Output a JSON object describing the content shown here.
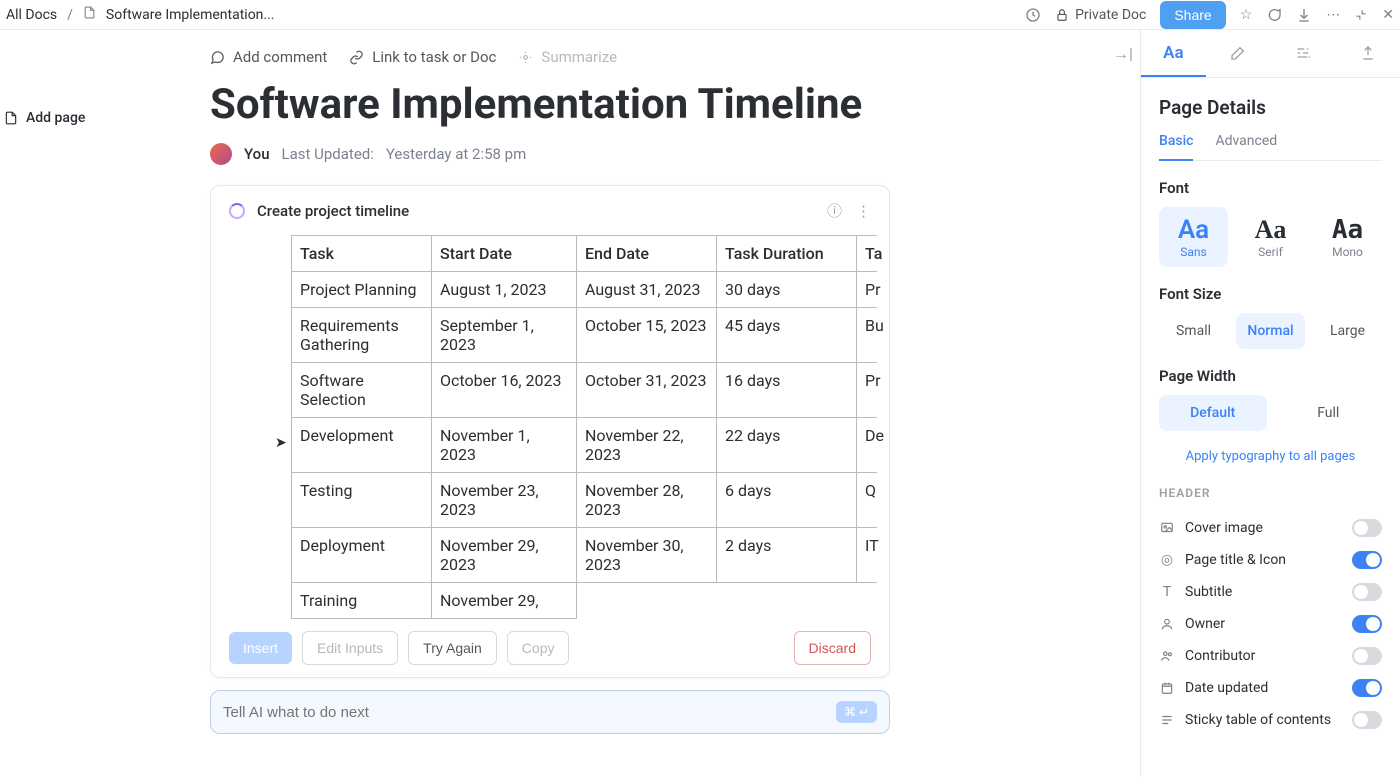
{
  "breadcrumb": {
    "root": "All Docs",
    "current": "Software Implementation..."
  },
  "topbar": {
    "privacy": "Private Doc",
    "share": "Share"
  },
  "left_rail": {
    "add_page": "Add page"
  },
  "doc_actions": {
    "comment": "Add comment",
    "link_task": "Link to task or Doc",
    "summarize": "Summarize"
  },
  "document": {
    "title": "Software Implementation Timeline",
    "author": "You",
    "last_updated_label": "Last Updated:",
    "last_updated_value": "Yesterday at 2:58 pm"
  },
  "ai_card": {
    "prompt_title": "Create project timeline",
    "columns": [
      "Task",
      "Start Date",
      "End Date",
      "Task Duration",
      "Ta"
    ],
    "rows": [
      {
        "task": "Project Planning",
        "start": "August 1, 2023",
        "end": "August 31, 2023",
        "dur": "30 days",
        "extra": "Pr"
      },
      {
        "task": "Requirements Gathering",
        "start": "September 1, 2023",
        "end": "October 15, 2023",
        "dur": "45 days",
        "extra": "Bu"
      },
      {
        "task": "Software Selection",
        "start": "October 16, 2023",
        "end": "October 31, 2023",
        "dur": "16 days",
        "extra": "Pr"
      },
      {
        "task": "Development",
        "start": "November 1, 2023",
        "end": "November 22, 2023",
        "dur": "22 days",
        "extra": "De"
      },
      {
        "task": "Testing",
        "start": "November 23, 2023",
        "end": "November 28, 2023",
        "dur": "6 days",
        "extra": "Q"
      },
      {
        "task": "Deployment",
        "start": "November 29, 2023",
        "end": "November 30, 2023",
        "dur": "2 days",
        "extra": "IT"
      },
      {
        "task": "Training",
        "start": "November 29,",
        "end": "",
        "dur": "",
        "extra": ""
      }
    ],
    "buttons": {
      "insert": "Insert",
      "edit_inputs": "Edit Inputs",
      "try_again": "Try Again",
      "copy": "Copy",
      "discard": "Discard"
    },
    "input_placeholder": "Tell AI what to do next",
    "kbd_hint": "⌘ ↵"
  },
  "sidebar": {
    "title": "Page Details",
    "subtabs": {
      "basic": "Basic",
      "advanced": "Advanced"
    },
    "font_label": "Font",
    "fonts": {
      "sans": "Sans",
      "serif": "Serif",
      "mono": "Mono"
    },
    "font_size_label": "Font Size",
    "sizes": {
      "small": "Small",
      "normal": "Normal",
      "large": "Large"
    },
    "page_width_label": "Page Width",
    "widths": {
      "default": "Default",
      "full": "Full"
    },
    "apply_all": "Apply typography to all pages",
    "header_label": "HEADER",
    "toggles": {
      "cover": "Cover image",
      "title_icon": "Page title & Icon",
      "subtitle": "Subtitle",
      "owner": "Owner",
      "contributor": "Contributor",
      "date_updated": "Date updated",
      "sticky_toc": "Sticky table of contents"
    }
  }
}
